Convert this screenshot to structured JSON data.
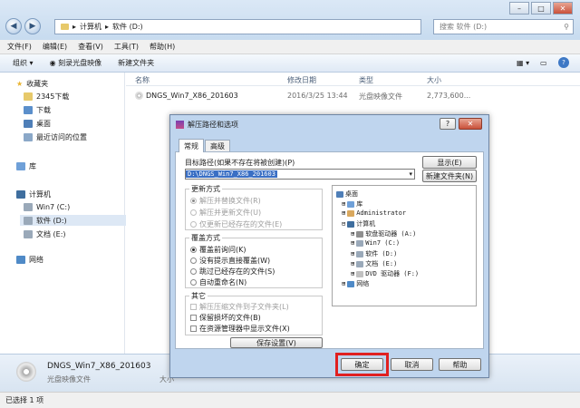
{
  "explorer": {
    "breadcrumb": [
      "计算机",
      "软件 (D:)"
    ],
    "search_placeholder": "搜索 软件 (D:)",
    "menu": [
      "文件(F)",
      "编辑(E)",
      "查看(V)",
      "工具(T)",
      "帮助(H)"
    ],
    "toolbar": [
      "组织",
      "刻录光盘映像",
      "新建文件夹"
    ],
    "sidebar": {
      "favorites_header": "收藏夹",
      "favorites": [
        "2345下载",
        "下载",
        "桌面",
        "最近访问的位置"
      ],
      "library": "库",
      "computer_header": "计算机",
      "drives": [
        "Win7 (C:)",
        "软件 (D:)",
        "文档 (E:)"
      ],
      "network": "网络"
    },
    "columns": [
      "名称",
      "修改日期",
      "类型",
      "大小"
    ],
    "file": {
      "name": "DNGS_Win7_X86_201603",
      "date": "2016/3/25 13:44",
      "type": "光盘映像文件",
      "size": "2,773,600..."
    },
    "details": {
      "name": "DNGS_Win7_X86_201603",
      "type": "光盘映像文件",
      "size_prefix": "大小"
    },
    "status": "已选择 1 项"
  },
  "dialog": {
    "title": "解压路径和选项",
    "tabs": [
      "常规",
      "高级"
    ],
    "path_label": "目标路径(如果不存在将被创建)(P)",
    "path_value": "D:\\DNGS_Win7_X86_201603",
    "btn_show": "显示(E)",
    "btn_new_folder": "新建文件夹(N)",
    "update_group": {
      "title": "更新方式",
      "options": [
        "解压并替换文件(R)",
        "解压并更新文件(U)",
        "仅更新已经存在的文件(E)"
      ]
    },
    "overwrite_group": {
      "title": "覆盖方式",
      "options": [
        "覆盖前询问(K)",
        "没有提示直接覆盖(W)",
        "跳过已经存在的文件(S)",
        "自动重命名(N)"
      ]
    },
    "other_group": {
      "title": "其它",
      "options": [
        "解压压缩文件到子文件夹(L)",
        "保留损坏的文件(B)",
        "在资源管理器中显示文件(X)"
      ]
    },
    "btn_save": "保存设置(V)",
    "tree": [
      "桌面",
      "库",
      "Administrator",
      "计算机",
      "软盘驱动器 (A:)",
      "Win7 (C:)",
      "软件 (D:)",
      "文档 (E:)",
      "DVD 驱动器 (F:)",
      "网络"
    ],
    "btn_ok": "确定",
    "btn_cancel": "取消",
    "btn_help": "帮助"
  },
  "colors": {
    "highlight": "#e02020",
    "selection": "#3a6fc4"
  }
}
